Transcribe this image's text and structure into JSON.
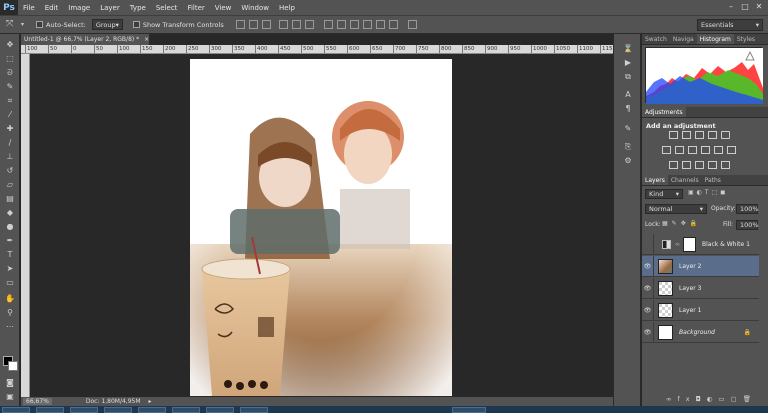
{
  "app": {
    "logo": "Ps"
  },
  "menu": [
    "File",
    "Edit",
    "Image",
    "Layer",
    "Type",
    "Select",
    "Filter",
    "View",
    "Window",
    "Help"
  ],
  "options": {
    "auto_select_label": "Auto-Select:",
    "auto_select_value": "Group",
    "show_transform_label": "Show Transform Controls",
    "workspace": "Essentials"
  },
  "document": {
    "tab_title": "Untitled-1 @ 66,7% (Layer 2, RGB/8) *",
    "zoom": "66,67%",
    "doc_size": "Doc: 1,80M/4,95M"
  },
  "ruler_ticks": [
    "100",
    "50",
    "0",
    "50",
    "100",
    "150",
    "200",
    "250",
    "300",
    "350",
    "400",
    "450",
    "500",
    "550",
    "600",
    "650",
    "700",
    "750",
    "800",
    "850",
    "900",
    "950",
    "1000",
    "1050",
    "1100",
    "115"
  ],
  "panels": {
    "top_tabs": [
      "Swatch",
      "Naviga",
      "Histogram",
      "Styles"
    ],
    "active_top_tab": "Histogram",
    "adjustments_tab": "Adjustments",
    "adjustments_heading": "Add an adjustment",
    "layer_tabs": [
      "Layers",
      "Channels",
      "Paths"
    ],
    "kind_label": "Kind",
    "blend_mode": "Normal",
    "opacity_label": "Opacity:",
    "opacity_value": "100%",
    "lock_label": "Lock:",
    "fill_label": "Fill:",
    "fill_value": "100%"
  },
  "layers": [
    {
      "name": "Black & White 1",
      "visible": false,
      "selected": false,
      "thumb": "adjustment"
    },
    {
      "name": "Layer 2",
      "visible": true,
      "selected": true,
      "thumb": "photo"
    },
    {
      "name": "Layer 3",
      "visible": true,
      "selected": false,
      "thumb": "transparent"
    },
    {
      "name": "Layer 1",
      "visible": true,
      "selected": false,
      "thumb": "transparent"
    },
    {
      "name": "Background",
      "visible": true,
      "selected": false,
      "thumb": "white",
      "locked": true
    }
  ],
  "colors": {
    "chrome": "#535353",
    "workspace": "#282828",
    "selected_layer": "#5a6d8a",
    "accent": "#8ecbff"
  }
}
